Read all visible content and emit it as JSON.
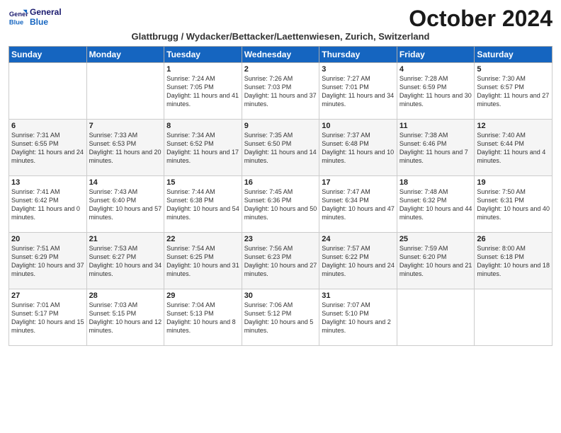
{
  "header": {
    "logo_line1": "General",
    "logo_line2": "Blue",
    "month": "October 2024",
    "location": "Glattbrugg / Wydacker/Bettacker/Laettenwiesen, Zurich, Switzerland"
  },
  "days_of_week": [
    "Sunday",
    "Monday",
    "Tuesday",
    "Wednesday",
    "Thursday",
    "Friday",
    "Saturday"
  ],
  "weeks": [
    [
      {
        "day": "",
        "info": ""
      },
      {
        "day": "",
        "info": ""
      },
      {
        "day": "1",
        "info": "Sunrise: 7:24 AM\nSunset: 7:05 PM\nDaylight: 11 hours and 41 minutes."
      },
      {
        "day": "2",
        "info": "Sunrise: 7:26 AM\nSunset: 7:03 PM\nDaylight: 11 hours and 37 minutes."
      },
      {
        "day": "3",
        "info": "Sunrise: 7:27 AM\nSunset: 7:01 PM\nDaylight: 11 hours and 34 minutes."
      },
      {
        "day": "4",
        "info": "Sunrise: 7:28 AM\nSunset: 6:59 PM\nDaylight: 11 hours and 30 minutes."
      },
      {
        "day": "5",
        "info": "Sunrise: 7:30 AM\nSunset: 6:57 PM\nDaylight: 11 hours and 27 minutes."
      }
    ],
    [
      {
        "day": "6",
        "info": "Sunrise: 7:31 AM\nSunset: 6:55 PM\nDaylight: 11 hours and 24 minutes."
      },
      {
        "day": "7",
        "info": "Sunrise: 7:33 AM\nSunset: 6:53 PM\nDaylight: 11 hours and 20 minutes."
      },
      {
        "day": "8",
        "info": "Sunrise: 7:34 AM\nSunset: 6:52 PM\nDaylight: 11 hours and 17 minutes."
      },
      {
        "day": "9",
        "info": "Sunrise: 7:35 AM\nSunset: 6:50 PM\nDaylight: 11 hours and 14 minutes."
      },
      {
        "day": "10",
        "info": "Sunrise: 7:37 AM\nSunset: 6:48 PM\nDaylight: 11 hours and 10 minutes."
      },
      {
        "day": "11",
        "info": "Sunrise: 7:38 AM\nSunset: 6:46 PM\nDaylight: 11 hours and 7 minutes."
      },
      {
        "day": "12",
        "info": "Sunrise: 7:40 AM\nSunset: 6:44 PM\nDaylight: 11 hours and 4 minutes."
      }
    ],
    [
      {
        "day": "13",
        "info": "Sunrise: 7:41 AM\nSunset: 6:42 PM\nDaylight: 11 hours and 0 minutes."
      },
      {
        "day": "14",
        "info": "Sunrise: 7:43 AM\nSunset: 6:40 PM\nDaylight: 10 hours and 57 minutes."
      },
      {
        "day": "15",
        "info": "Sunrise: 7:44 AM\nSunset: 6:38 PM\nDaylight: 10 hours and 54 minutes."
      },
      {
        "day": "16",
        "info": "Sunrise: 7:45 AM\nSunset: 6:36 PM\nDaylight: 10 hours and 50 minutes."
      },
      {
        "day": "17",
        "info": "Sunrise: 7:47 AM\nSunset: 6:34 PM\nDaylight: 10 hours and 47 minutes."
      },
      {
        "day": "18",
        "info": "Sunrise: 7:48 AM\nSunset: 6:32 PM\nDaylight: 10 hours and 44 minutes."
      },
      {
        "day": "19",
        "info": "Sunrise: 7:50 AM\nSunset: 6:31 PM\nDaylight: 10 hours and 40 minutes."
      }
    ],
    [
      {
        "day": "20",
        "info": "Sunrise: 7:51 AM\nSunset: 6:29 PM\nDaylight: 10 hours and 37 minutes."
      },
      {
        "day": "21",
        "info": "Sunrise: 7:53 AM\nSunset: 6:27 PM\nDaylight: 10 hours and 34 minutes."
      },
      {
        "day": "22",
        "info": "Sunrise: 7:54 AM\nSunset: 6:25 PM\nDaylight: 10 hours and 31 minutes."
      },
      {
        "day": "23",
        "info": "Sunrise: 7:56 AM\nSunset: 6:23 PM\nDaylight: 10 hours and 27 minutes."
      },
      {
        "day": "24",
        "info": "Sunrise: 7:57 AM\nSunset: 6:22 PM\nDaylight: 10 hours and 24 minutes."
      },
      {
        "day": "25",
        "info": "Sunrise: 7:59 AM\nSunset: 6:20 PM\nDaylight: 10 hours and 21 minutes."
      },
      {
        "day": "26",
        "info": "Sunrise: 8:00 AM\nSunset: 6:18 PM\nDaylight: 10 hours and 18 minutes."
      }
    ],
    [
      {
        "day": "27",
        "info": "Sunrise: 7:01 AM\nSunset: 5:17 PM\nDaylight: 10 hours and 15 minutes."
      },
      {
        "day": "28",
        "info": "Sunrise: 7:03 AM\nSunset: 5:15 PM\nDaylight: 10 hours and 12 minutes."
      },
      {
        "day": "29",
        "info": "Sunrise: 7:04 AM\nSunset: 5:13 PM\nDaylight: 10 hours and 8 minutes."
      },
      {
        "day": "30",
        "info": "Sunrise: 7:06 AM\nSunset: 5:12 PM\nDaylight: 10 hours and 5 minutes."
      },
      {
        "day": "31",
        "info": "Sunrise: 7:07 AM\nSunset: 5:10 PM\nDaylight: 10 hours and 2 minutes."
      },
      {
        "day": "",
        "info": ""
      },
      {
        "day": "",
        "info": ""
      }
    ]
  ]
}
